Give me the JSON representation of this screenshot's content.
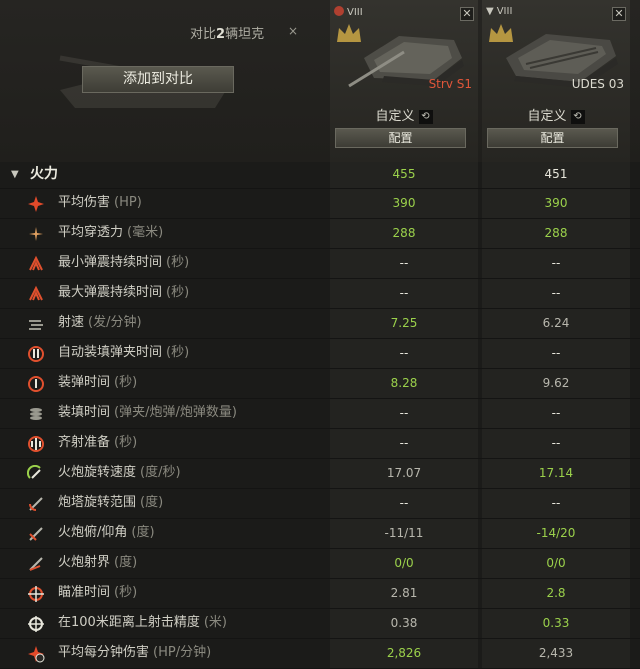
{
  "header": {
    "compare_prefix": "对比",
    "compare_count": "2",
    "compare_suffix": "辆坦克",
    "close_label": "×",
    "add_button": "添加到对比"
  },
  "tanks": [
    {
      "tier": "VIII",
      "name": "Strv S1",
      "custom_label": "自定义",
      "undo": "⟲",
      "config_button": "配置",
      "close": "✕"
    },
    {
      "tier": "VIII",
      "name": "UDES 03",
      "custom_label": "自定义",
      "undo": "⟲",
      "config_button": "配置",
      "close": "✕"
    }
  ],
  "section": {
    "title": "火力",
    "arrow": "▼",
    "values": [
      "455",
      "451"
    ]
  },
  "rows": [
    {
      "label": "平均伤害",
      "unit": "(HP)",
      "v1": "390",
      "v2": "390"
    },
    {
      "label": "平均穿透力",
      "unit": "(毫米)",
      "v1": "288",
      "v2": "288"
    },
    {
      "label": "最小弹震持续时间",
      "unit": "(秒)",
      "v1": "--",
      "v2": "--"
    },
    {
      "label": "最大弹震持续时间",
      "unit": "(秒)",
      "v1": "--",
      "v2": "--"
    },
    {
      "label": "射速",
      "unit": "(发/分钟)",
      "v1": "7.25",
      "v2": "6.24"
    },
    {
      "label": "自动装填弹夹时间",
      "unit": "(秒)",
      "v1": "--",
      "v2": "--"
    },
    {
      "label": "装弹时间",
      "unit": "(秒)",
      "v1": "8.28",
      "v2": "9.62"
    },
    {
      "label": "装填时间",
      "unit": "(弹夹/炮弹/炮弹数量)",
      "v1": "--",
      "v2": "--"
    },
    {
      "label": "齐射准备",
      "unit": "(秒)",
      "v1": "--",
      "v2": "--"
    },
    {
      "label": "火炮旋转速度",
      "unit": "(度/秒)",
      "v1": "17.07",
      "v2": "17.14"
    },
    {
      "label": "炮塔旋转范围",
      "unit": "(度)",
      "v1": "--",
      "v2": "--"
    },
    {
      "label": "火炮俯/仰角",
      "unit": "(度)",
      "v1": "-11/11",
      "v2": "-14/20"
    },
    {
      "label": "火炮射界",
      "unit": "(度)",
      "v1": "0/0",
      "v2": "0/0"
    },
    {
      "label": "瞄准时间",
      "unit": "(秒)",
      "v1": "2.81",
      "v2": "2.8"
    },
    {
      "label": "在100米距离上射击精度",
      "unit": "(米)",
      "v1": "0.38",
      "v2": "0.33"
    },
    {
      "label": "平均每分钟伤害",
      "unit": "(HP/分钟)",
      "v1": "2,826",
      "v2": "2,433"
    }
  ],
  "colors": {
    "highlight": "#9bd14b",
    "neutral": "#b8b7ad",
    "accent_red": "#e0563a",
    "crown": "#e2b84a"
  }
}
